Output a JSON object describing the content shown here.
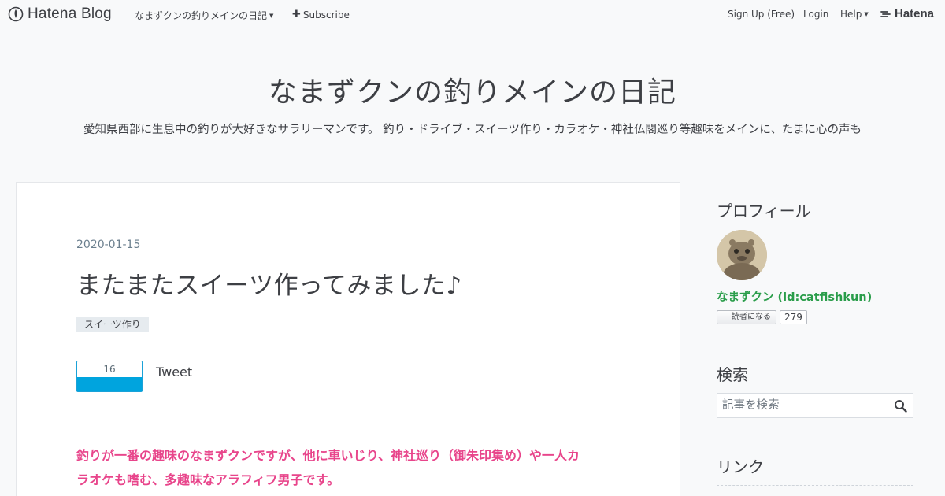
{
  "topbar": {
    "brand": "Hatena Blog",
    "blog_menu": "なまずクンの釣りメインの日記",
    "subscribe": "Subscribe",
    "signup": "Sign Up (Free)",
    "login": "Login",
    "help": "Help",
    "hatena": "Hatena"
  },
  "blog": {
    "title": "なまずクンの釣りメインの日記",
    "description": "愛知県西部に生息中の釣りが大好きなサラリーマンです。 釣り・ドライブ・スイーツ作り・カラオケ・神社仏閣巡り等趣味をメインに、たまに心の声も"
  },
  "entry": {
    "date": "2020-01-15",
    "title": "またまたスイーツ作ってみました♪",
    "category": "スイーツ作り",
    "bookmark_count": "16",
    "tweet": "Tweet",
    "body_line1": "釣りが一番の趣味のなまずクンですが、他に車いじり、神社巡り（御朱印集め）や一人カ",
    "body_line2": "ラオケも嗜む、多趣味なアラフィフ男子です。"
  },
  "sidebar": {
    "profile_heading": "プロフィール",
    "profile_name": "なまずクン (id:catfishkun)",
    "subscribe_label": "読者になる",
    "subscriber_count": "279",
    "search_heading": "検索",
    "search_placeholder": "記事を検索",
    "links_heading": "リンク"
  },
  "colors": {
    "accent_green": "#2a9d4a",
    "body_pink": "#e8458b",
    "bookmark_blue": "#00a4de"
  },
  "icons": [
    "hatena-blog-logo-icon",
    "caret-down-icon",
    "plus-icon",
    "hatena-logo-icon",
    "search-icon"
  ]
}
